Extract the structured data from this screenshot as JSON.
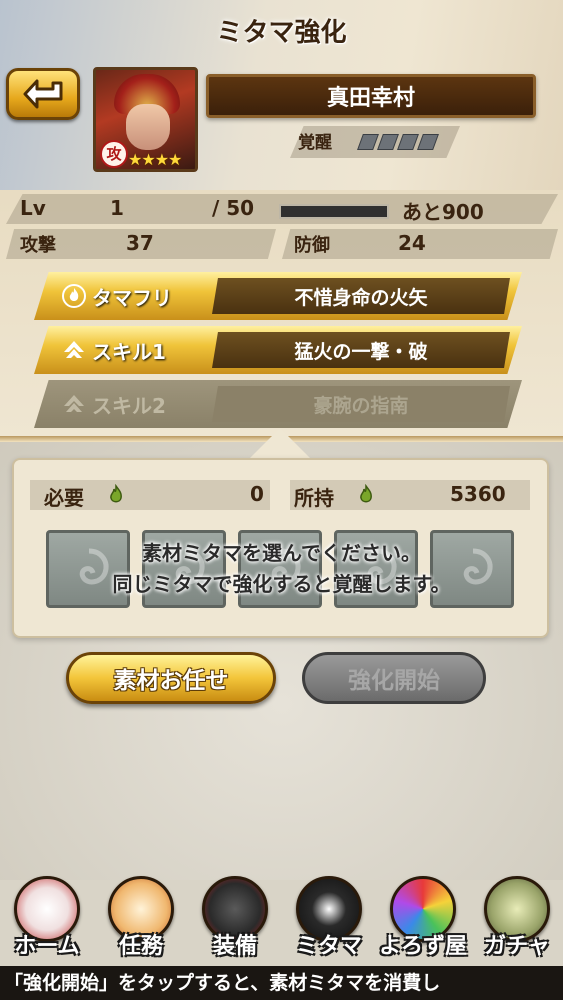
{
  "header": {
    "title": "ミタマ強化"
  },
  "character": {
    "name": "真田幸村",
    "type_badge": "攻",
    "stars": "★★★★",
    "awakening_label": "覚醒"
  },
  "stats": {
    "lv_label": "Lv",
    "lv_value": "1",
    "lv_max": "/ 50",
    "xp_progress": 0.0,
    "xp_remaining": "あと900",
    "attack_label": "攻撃",
    "attack_value": "37",
    "defense_label": "防御",
    "defense_value": "24"
  },
  "skills": [
    {
      "label": "タマフリ",
      "value": "不惜身命の火矢",
      "icon": "flame-icon"
    },
    {
      "label": "スキル1",
      "value": "猛火の一撃・破",
      "icon": "skill-arrow-icon"
    },
    {
      "label": "スキル2",
      "value": "豪腕の指南",
      "icon": "skill-arrow-icon"
    }
  ],
  "materials": {
    "required_label": "必要",
    "required_value": "0",
    "owned_label": "所持",
    "owned_value": "5360",
    "hint_line1": "素材ミタマを選んでください。",
    "hint_line2": "同じミタマで強化すると覚醒します。"
  },
  "buttons": {
    "auto_select": "素材お任せ",
    "start": "強化開始"
  },
  "nav": [
    {
      "label": "ホーム",
      "icon": "fox-mask-icon"
    },
    {
      "label": "任務",
      "icon": "scroll-icon"
    },
    {
      "label": "装備",
      "icon": "armor-icon"
    },
    {
      "label": "ミタマ",
      "icon": "spirit-swirl-icon"
    },
    {
      "label": "よろず屋",
      "icon": "shop-flower-icon"
    },
    {
      "label": "ガチャ",
      "icon": "gacha-stone-icon"
    }
  ],
  "ticker": "「強化開始」をタップすると、素材ミタマを消費し"
}
